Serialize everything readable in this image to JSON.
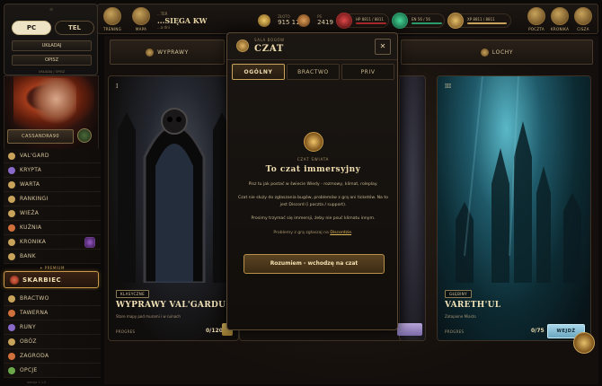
{
  "device_popup": {
    "grip": "≡",
    "pc_label": "PC",
    "tel_label": "TEL",
    "layout_label": "UKŁADAJ",
    "describe_label": "OPISZ",
    "footer": "UKŁADAJ / OPISZ"
  },
  "topbar": {
    "trening_label": "TRENING",
    "mapa_label": "MAPA",
    "name_small": "...TER",
    "name_big": "...SIĘGA KW",
    "name_sub": "...a dni",
    "zloto_label": "ZŁOTO",
    "zloto_value": "915 118",
    "ps_label": "PS",
    "ps_value": "2419",
    "hp_text": "HP 8811 / 8811",
    "en_text": "EN 56 / 56",
    "xp_text": "XP 8811 / 8811",
    "poczta_label": "POCZTA",
    "kronika_label": "KRONIKA",
    "cisza_label": "CISZA"
  },
  "character": {
    "button_label": "CASSANDRA90"
  },
  "nav": {
    "items_top": [
      {
        "label": "VAL'GARD",
        "color": "#c9a35a"
      },
      {
        "label": "KRYPTA",
        "color": "#8a6ac8"
      },
      {
        "label": "WARTA",
        "color": "#c9a35a"
      },
      {
        "label": "RANKINGI",
        "color": "#c9a35a"
      },
      {
        "label": "WIEŻA",
        "color": "#c9a35a"
      },
      {
        "label": "KUŹNIA",
        "color": "#d0703a"
      },
      {
        "label": "KRONIKA",
        "color": "#c9a35a"
      },
      {
        "label": "BANK",
        "color": "#c9a35a"
      }
    ],
    "premium_label": "✦ PREMIUM",
    "skarbiec_label": "SKARBIEC",
    "items_bottom": [
      {
        "label": "BRACTWO",
        "color": "#c9a35a"
      },
      {
        "label": "TAWERNA",
        "color": "#d0703a"
      },
      {
        "label": "RUNY",
        "color": "#8a6ac8"
      },
      {
        "label": "OBÓZ",
        "color": "#c9a35a"
      },
      {
        "label": "ZAGRODA",
        "color": "#d0703a"
      },
      {
        "label": "OPCJE",
        "color": "#6aa84a"
      }
    ],
    "version": "wersja 1.1.0"
  },
  "main": {
    "tabs": {
      "wyprawy": "WYPRAWY",
      "lochy": "LOCHY"
    },
    "cards": [
      {
        "roman": "I",
        "tag": "KLASYCZNE",
        "title": "WYPRAWY VAL'GARDU",
        "subtitle": "Stare mapy pod murami i w ruinach",
        "progress_label": "PROGRES",
        "progress_value": "0/120"
      },
      {
        "roman": "III",
        "tag": "GŁĘBINY",
        "title": "VARETH'UL",
        "subtitle": "Zatopione Miasto",
        "progress_label": "PROGRES",
        "progress_value": "0/75",
        "enter_label": "WEJDŹ"
      }
    ]
  },
  "modal": {
    "kicker": "SALA BOGÓW",
    "title": "CZAT",
    "close": "✕",
    "tabs": [
      "OGÓLNY",
      "BRACTWO",
      "PRIV"
    ],
    "body_kicker": "CZAT ŚWIATA",
    "body_title": "To czat immersyjny",
    "para1": "Pisz tu jak postać w świecie Wiedy - rozmowy, klimat, roleplay.",
    "para2": "Czat nie służy do zgłaszania bugów, problemów z grą ani ticketów. Na to jest Discord (i poczta / support).",
    "para3": "Prosimy trzymać się immersji, żeby nie psuć klimatu innym.",
    "para4_prefix": "Problemy z grą zgłaszaj na ",
    "para4_link": "Discordzie",
    "para4_suffix": ".",
    "confirm_label": "Rozumiem - wchodzę na czat"
  },
  "colors": {
    "accent_gold": "#c9a35a",
    "hp_red": "#b02a2a",
    "en_green": "#2a9a6a",
    "enter_blue": "#8fc3d8"
  }
}
